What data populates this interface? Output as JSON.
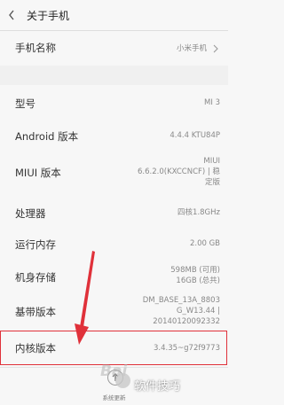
{
  "header": {
    "title": "关于手机"
  },
  "device_name": {
    "label": "手机名称",
    "value": "小米手机"
  },
  "rows": [
    {
      "label": "型号",
      "value": "MI 3"
    },
    {
      "label": "Android 版本",
      "value": "4.4.4 KTU84P"
    },
    {
      "label": "MIUI 版本",
      "value_lines": [
        "MIUI",
        "6.6.2.0(KXCCNCF) | 稳",
        "定版"
      ]
    },
    {
      "label": "处理器",
      "value": "四核1.8GHz"
    },
    {
      "label": "运行内存",
      "value": "2.00 GB"
    },
    {
      "label": "机身存储",
      "value_lines": [
        "598MB (可用)",
        "16GB (总共)"
      ]
    },
    {
      "label": "基带版本",
      "value_lines": [
        "DM_BASE_13A_8803",
        "G_W13.44 |",
        "20140120092332"
      ]
    },
    {
      "label": "内核版本",
      "value": "3.4.35~g72f9773"
    }
  ],
  "bottom": {
    "update_label": "系统更新"
  },
  "watermark": {
    "text": "软件技巧",
    "logo": "Bai"
  },
  "colors": {
    "highlight": "#e0313a",
    "arrow": "#e0313a"
  }
}
